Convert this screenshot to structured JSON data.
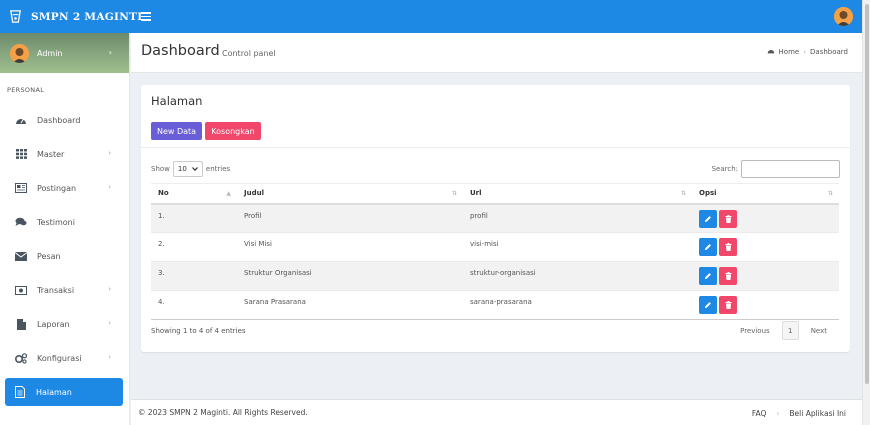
{
  "brand": {
    "name": "SMPN 2 MAGINTI",
    "logo_icon": "school-logo-icon"
  },
  "colors": {
    "primary": "#1e88e5",
    "purple": "#6a5dd8",
    "danger": "#f0476b"
  },
  "sidebar": {
    "user": {
      "name": "Admin"
    },
    "section_label": "PERSONAL",
    "items": [
      {
        "label": "Dashboard",
        "icon": "dashboard-icon",
        "has_children": false
      },
      {
        "label": "Master",
        "icon": "grid-icon",
        "has_children": true
      },
      {
        "label": "Postingan",
        "icon": "newspaper-icon",
        "has_children": true
      },
      {
        "label": "Testimoni",
        "icon": "chat-icon",
        "has_children": false
      },
      {
        "label": "Pesan",
        "icon": "envelope-icon",
        "has_children": false
      },
      {
        "label": "Transaksi",
        "icon": "money-icon",
        "has_children": true
      },
      {
        "label": "Laporan",
        "icon": "file-icon",
        "has_children": true
      },
      {
        "label": "Konfigurasi",
        "icon": "cogs-icon",
        "has_children": true
      },
      {
        "label": "Halaman",
        "icon": "page-icon",
        "has_children": false,
        "active": true
      }
    ]
  },
  "header": {
    "title": "Dashboard",
    "subtitle": "Control panel",
    "breadcrumb": {
      "home": "Home",
      "separator": "›",
      "current": "Dashboard"
    }
  },
  "box": {
    "title": "Halaman",
    "new_button": "New Data",
    "empty_button": "Kosongkan",
    "show_label": "Show",
    "entries_value": "10",
    "entries_label": "entries",
    "search_label": "Search:",
    "search_value": ""
  },
  "table": {
    "columns": [
      "No",
      "Judul",
      "Url",
      "Opsi"
    ],
    "rows": [
      {
        "no": "1.",
        "judul": "Profil",
        "url": "profil"
      },
      {
        "no": "2.",
        "judul": "Visi Misi",
        "url": "visi-misi"
      },
      {
        "no": "3.",
        "judul": "Struktur Organisasi",
        "url": "struktur-organisasi"
      },
      {
        "no": "4.",
        "judul": "Sarana Prasarana",
        "url": "sarana-prasarana"
      }
    ]
  },
  "pagination": {
    "info": "Showing 1 to 4 of 4 entries",
    "previous": "Previous",
    "current_page": "1",
    "next": "Next"
  },
  "footer": {
    "copyright": "© 2023 SMPN 2 Maginti. All Rights Reserved.",
    "links": [
      "FAQ",
      "Beli Aplikasi Ini"
    ],
    "separator": "›"
  }
}
